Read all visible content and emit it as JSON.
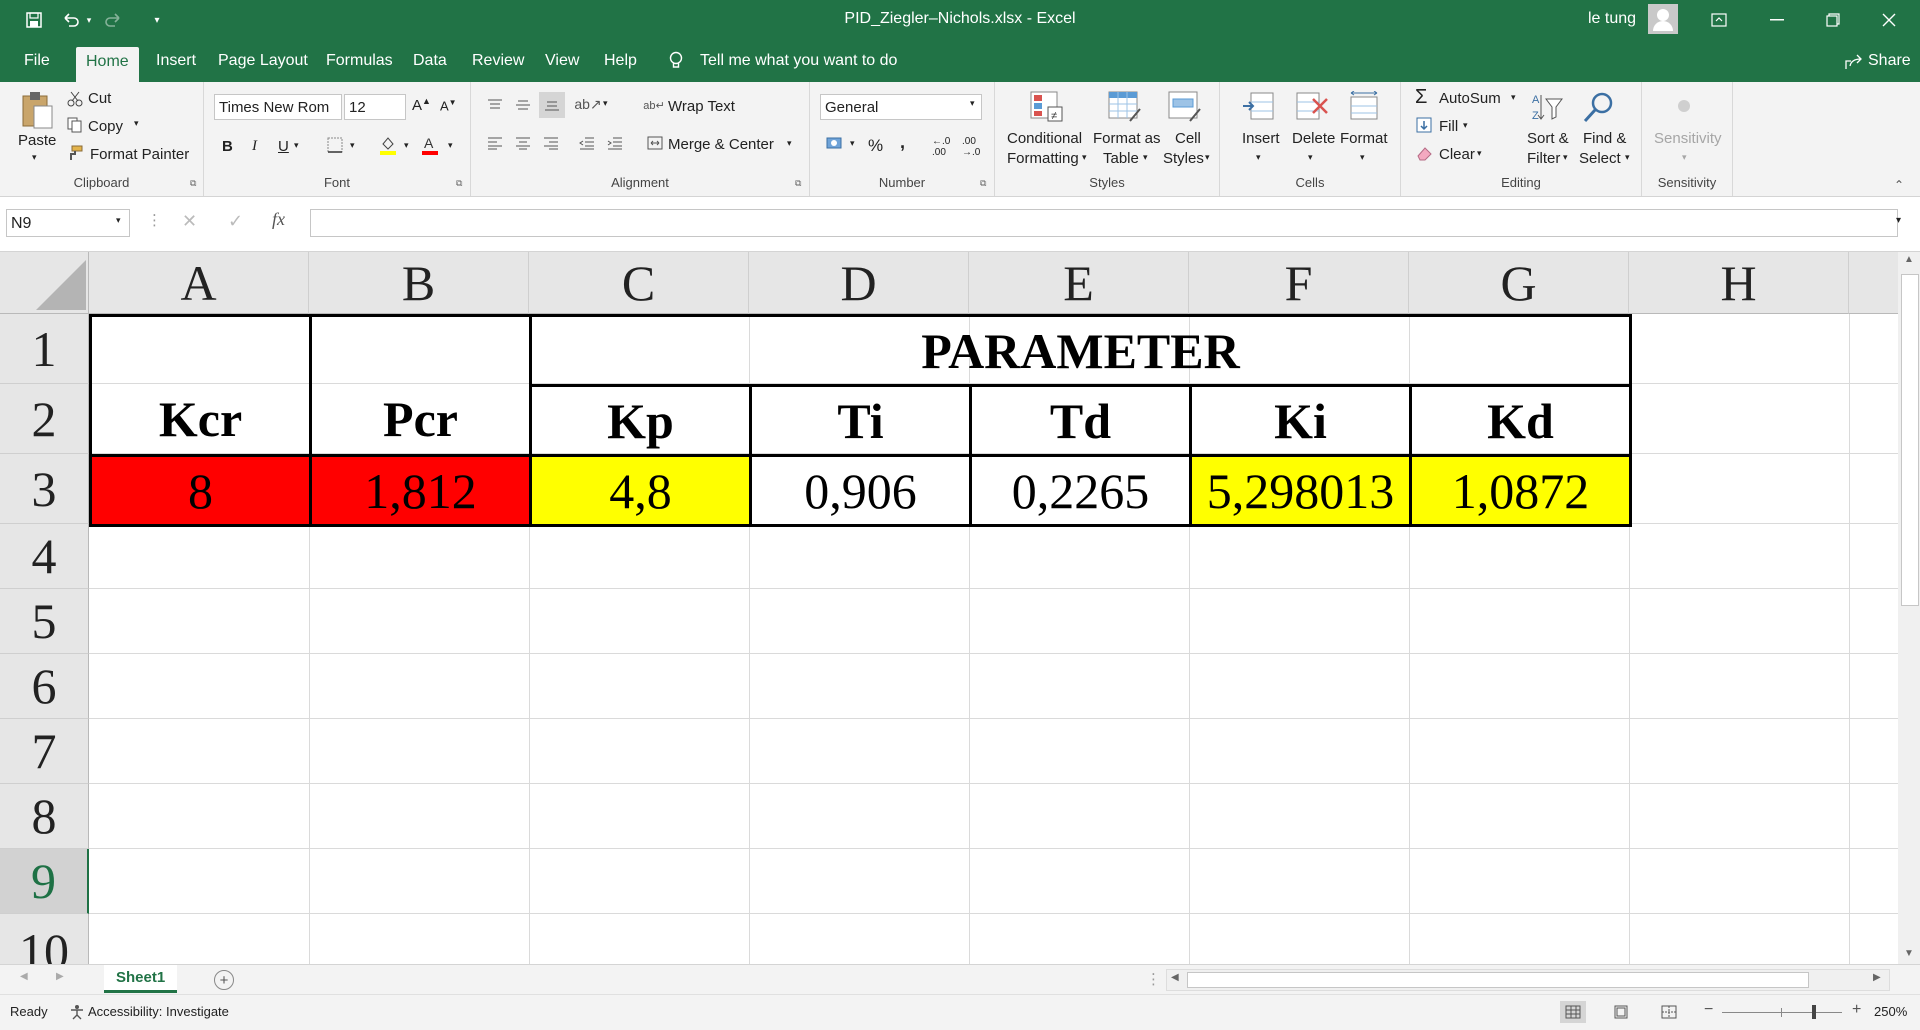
{
  "window": {
    "title": "PID_Ziegler–Nichols.xlsx  -  Excel",
    "user": "le tung"
  },
  "menu": {
    "tabs": [
      "File",
      "Home",
      "Insert",
      "Page Layout",
      "Formulas",
      "Data",
      "Review",
      "View",
      "Help"
    ],
    "active": "Home",
    "tell_me": "Tell me what you want to do",
    "share": "Share"
  },
  "ribbon": {
    "clipboard": {
      "paste": "Paste",
      "cut": "Cut",
      "copy": "Copy",
      "format_painter": "Format Painter",
      "label": "Clipboard"
    },
    "font": {
      "name": "Times New Rom",
      "size": "12",
      "bold": "B",
      "italic": "I",
      "underline": "U",
      "label": "Font"
    },
    "alignment": {
      "wrap": "Wrap Text",
      "merge": "Merge & Center",
      "label": "Alignment"
    },
    "number": {
      "format": "General",
      "percent": "%",
      "comma": ",",
      "label": "Number"
    },
    "styles": {
      "conditional": "Conditional",
      "conditional2": "Formatting",
      "format_table": "Format as",
      "format_table2": "Table",
      "cell_styles": "Cell",
      "cell_styles2": "Styles",
      "label": "Styles"
    },
    "cells": {
      "insert": "Insert",
      "delete": "Delete",
      "format": "Format",
      "label": "Cells"
    },
    "editing": {
      "autosum": "AutoSum",
      "fill": "Fill",
      "clear": "Clear",
      "sort": "Sort &",
      "sort2": "Filter",
      "find": "Find &",
      "find2": "Select",
      "label": "Editing"
    },
    "sensitivity": {
      "button": "Sensitivity",
      "label": "Sensitivity"
    }
  },
  "formula_bar": {
    "name_box": "N9",
    "fx": "fx",
    "value": ""
  },
  "sheet": {
    "columns": [
      "A",
      "B",
      "C",
      "D",
      "E",
      "F",
      "G",
      "H"
    ],
    "rows": [
      "1",
      "2",
      "3",
      "4",
      "5",
      "6",
      "7",
      "8",
      "9",
      "10"
    ],
    "merged_header": "PARAMETER",
    "headers": {
      "A": "Kcr",
      "B": "Pcr",
      "C": "Kp",
      "D": "Ti",
      "E": "Td",
      "F": "Ki",
      "G": "Kd"
    },
    "values": {
      "A": "8",
      "B": "1,812",
      "C": "4,8",
      "D": "0,906",
      "E": "0,2265",
      "F": "5,298013",
      "G": "1,0872"
    },
    "fills": {
      "A": "#ff0000",
      "B": "#ff0000",
      "C": "#ffff00",
      "D": "#ffffff",
      "E": "#ffffff",
      "F": "#ffff00",
      "G": "#ffff00"
    }
  },
  "sheet_tabs": {
    "active": "Sheet1"
  },
  "status": {
    "ready": "Ready",
    "accessibility": "Accessibility: Investigate",
    "zoom": "250%"
  },
  "colors": {
    "brand": "#217346",
    "selected_row": "#1e7145"
  }
}
